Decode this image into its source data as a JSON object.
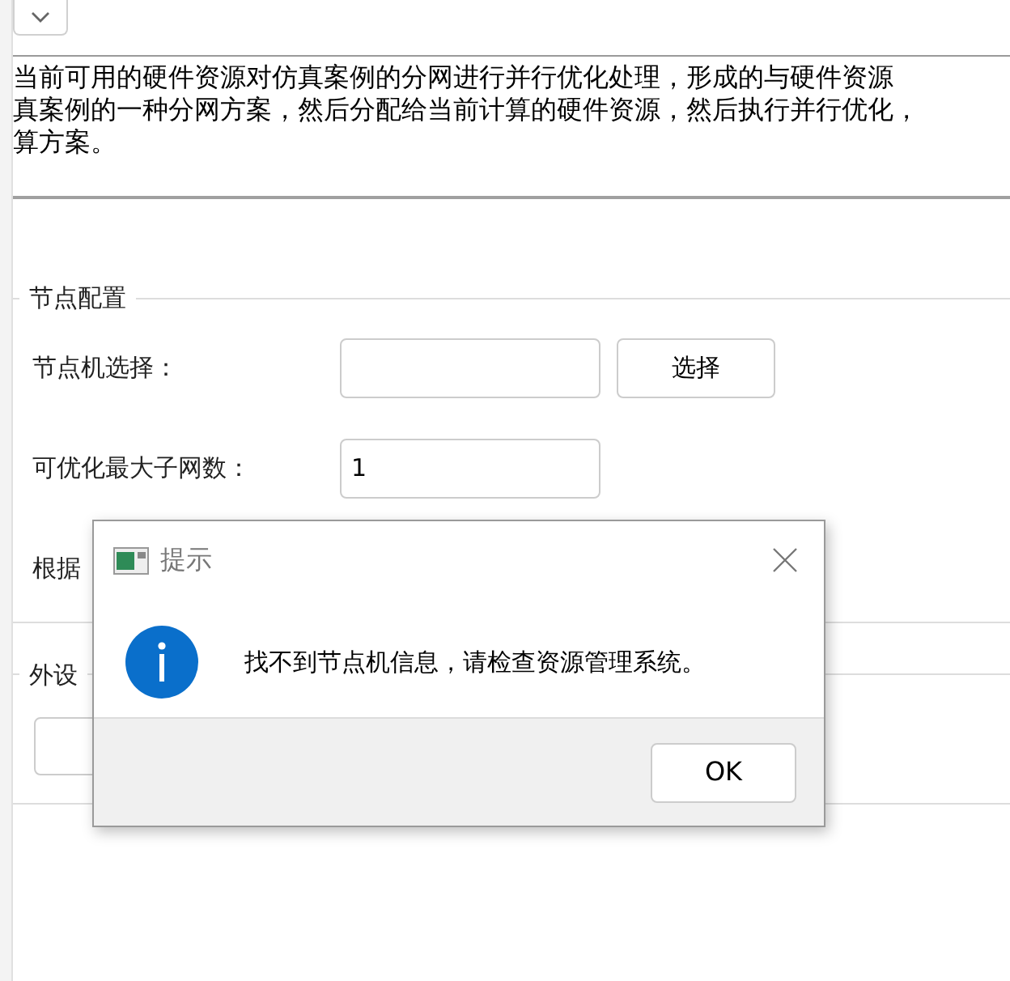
{
  "description": [
    "当前可用的硬件资源对仿真案例的分网进行并行优化处理，形成的与硬件资源",
    "真案例的一种分网方案，然后分配给当前计算的硬件资源，然后执行并行优化，",
    "算方案。"
  ],
  "node_group": {
    "title": "节点配置",
    "fields": [
      {
        "kind": "select",
        "label": "节点机选择：",
        "button": "选择"
      },
      {
        "kind": "input",
        "label": "可优化最大子网数：",
        "value": "1"
      },
      {
        "kind": "label",
        "label": "根据"
      }
    ]
  },
  "peripheral_group": {
    "title": "外设"
  },
  "dialog": {
    "title": "提示",
    "message": "找不到节点机信息，请检查资源管理系统。",
    "button": "OK"
  }
}
